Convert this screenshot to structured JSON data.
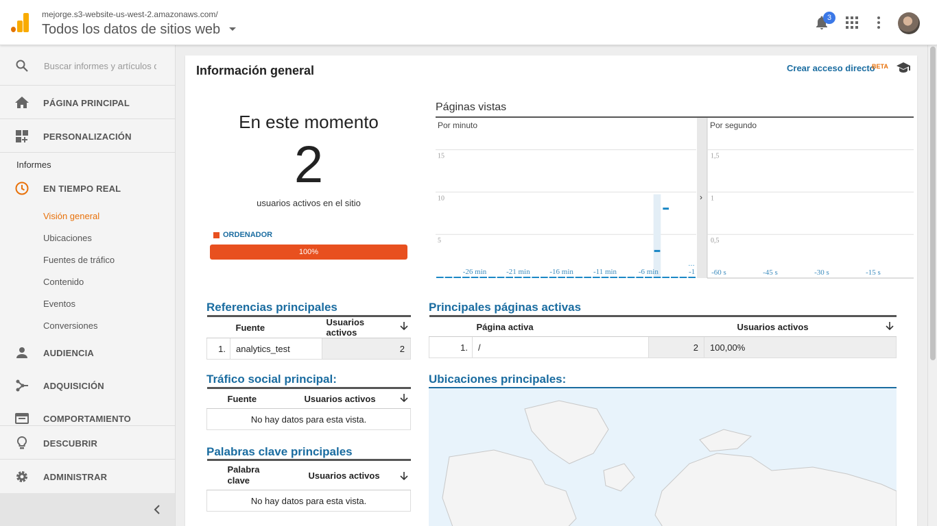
{
  "header": {
    "account_url": "mejorge.s3-website-us-west-2.amazonaws.com/",
    "view_name": "Todos los datos de sitios web",
    "notification_count": "3",
    "icons": [
      "analytics-logo-icon",
      "bell-icon",
      "apps-grid-icon",
      "more-vert-icon",
      "avatar"
    ]
  },
  "sidebar": {
    "search_placeholder": "Buscar informes y artículos de ayuda",
    "home": "PÁGINA PRINCIPAL",
    "customization": "PERSONALIZACIÓN",
    "reports_label": "Informes",
    "realtime": "EN TIEMPO REAL",
    "realtime_items": [
      "Visión general",
      "Ubicaciones",
      "Fuentes de tráfico",
      "Contenido",
      "Eventos",
      "Conversiones"
    ],
    "active_item": "Visión general",
    "audience": "AUDIENCIA",
    "acquisition": "ADQUISICIÓN",
    "behavior": "COMPORTAMIENTO",
    "discover": "DESCUBRIR",
    "admin": "ADMINISTRAR",
    "accent_color": "#e8710a"
  },
  "main": {
    "title": "Información general",
    "shortcut_label": "Crear acceso directo",
    "beta_label": "BETA",
    "now_title": "En este momento",
    "active_users": "2",
    "active_users_label": "usuarios activos en el sitio",
    "device_label": "ORDENADOR",
    "device_percent_label": "100%",
    "device_share": 1.0,
    "device_color": "#e8501f"
  },
  "chart_data": {
    "type": "bar",
    "title": "Páginas vistas",
    "panels": [
      {
        "name": "Por minuto",
        "tick_labels": [
          "-26 min",
          "-21 min",
          "-16 min",
          "-11 min",
          "-6 min",
          "-1"
        ],
        "y_ticks": [
          "5",
          "10",
          "15"
        ],
        "ylim": [
          0,
          18
        ],
        "x": [
          -30,
          -29,
          -28,
          -27,
          -26,
          -25,
          -24,
          -23,
          -22,
          -21,
          -20,
          -19,
          -18,
          -17,
          -16,
          -15,
          -14,
          -13,
          -12,
          -11,
          -10,
          -9,
          -8,
          -7,
          -6,
          -5,
          -4,
          -3,
          -2,
          -1
        ],
        "values": [
          0,
          0,
          0,
          0,
          0,
          0,
          0,
          0,
          0,
          0,
          0,
          0,
          0,
          0,
          0,
          0,
          0,
          0,
          0,
          0,
          0,
          0,
          0,
          0,
          0,
          3,
          8,
          0,
          0,
          0
        ],
        "highlighted_column": -5
      },
      {
        "name": "Por segundo",
        "tick_labels": [
          "-60 s",
          "-45 s",
          "-30 s",
          "-15 s"
        ],
        "y_ticks": [
          "0,5",
          "1",
          "1,5"
        ],
        "ylim": [
          0,
          1.8
        ],
        "values": []
      }
    ],
    "bar_color": "#1a87c5",
    "grid": true
  },
  "referrals": {
    "title": "Referencias principales",
    "headers": [
      "Fuente",
      "Usuarios activos"
    ],
    "rows": [
      {
        "rank": "1.",
        "source": "analytics_test",
        "users": "2"
      }
    ]
  },
  "active_pages": {
    "title": "Principales páginas activas",
    "headers": [
      "Página activa",
      "Usuarios activos"
    ],
    "rows": [
      {
        "rank": "1.",
        "page": "/",
        "users": "2",
        "percent": "100,00%"
      }
    ]
  },
  "social": {
    "title": "Tráfico social principal:",
    "headers": [
      "Fuente",
      "Usuarios activos"
    ],
    "empty": "No hay datos para esta vista."
  },
  "keywords": {
    "title": "Palabras clave principales",
    "headers": [
      "Palabra clave",
      "Usuarios activos"
    ],
    "empty": "No hay datos para esta vista."
  },
  "locations": {
    "title": "Ubicaciones principales:"
  }
}
